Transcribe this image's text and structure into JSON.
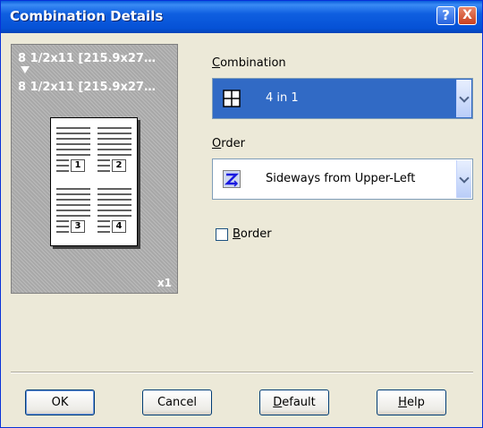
{
  "window": {
    "title": "Combination Details"
  },
  "titlebar": {
    "help_glyph": "?",
    "close_glyph": "X"
  },
  "preview": {
    "source_size": "8 1/2x11 [215.9x27…",
    "output_size": "8 1/2x11 [215.9x27…",
    "page_numbers": [
      "1",
      "2",
      "3",
      "4"
    ],
    "copies": "x1"
  },
  "combination": {
    "label_underlined": "C",
    "label_rest": "ombination",
    "value": "4 in 1",
    "icon": "grid-4up-icon"
  },
  "order": {
    "label_underlined": "O",
    "label_rest": "rder",
    "value": "Sideways from Upper-Left",
    "icon": "z-order-icon"
  },
  "border": {
    "label_underlined": "B",
    "label_rest": "order",
    "checked": false
  },
  "buttons": {
    "ok": "OK",
    "cancel": "Cancel",
    "default_underlined": "D",
    "default_rest": "efault",
    "help_underlined": "H",
    "help_rest": "elp"
  },
  "colors": {
    "titlebar": "#0551d6",
    "selection": "#316ac5",
    "dialog_bg": "#ece9d8"
  }
}
